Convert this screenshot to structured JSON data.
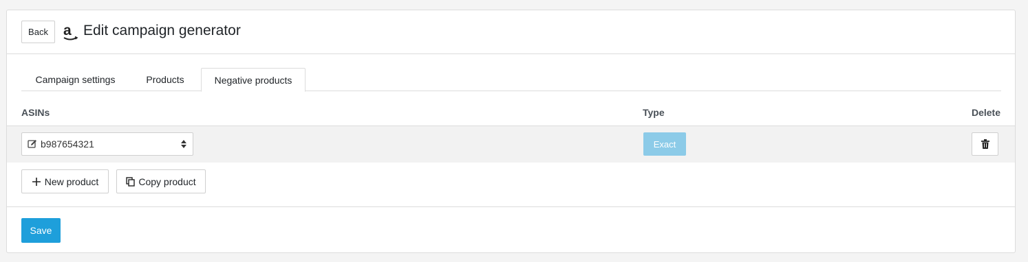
{
  "header": {
    "back_label": "Back",
    "brand_icon": "amazon-logo-icon",
    "title": "Edit campaign generator"
  },
  "tabs": [
    {
      "label": "Campaign settings",
      "active": false
    },
    {
      "label": "Products",
      "active": false
    },
    {
      "label": "Negative products",
      "active": true
    }
  ],
  "table": {
    "columns": {
      "asins": "ASINs",
      "type": "Type",
      "delete": "Delete"
    },
    "rows": [
      {
        "asin": "b987654321",
        "type": "Exact"
      }
    ]
  },
  "actions": {
    "new_product_label": "New product",
    "copy_product_label": "Copy product",
    "save_label": "Save"
  },
  "colors": {
    "primary": "#1e9fdb",
    "badge": "#8ccbe8"
  }
}
